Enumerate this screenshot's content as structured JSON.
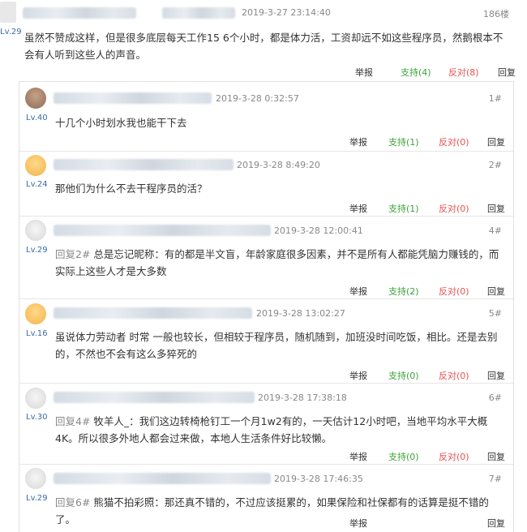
{
  "main_post": {
    "level": "Lv.29",
    "date": "2019-3-27 23:14:40",
    "floor": "186楼",
    "content": "虽然不赞成这样，但是很多底层每天工作15 6个小时，都是体力活，工资却远不如这些程序员，然鹅根本不会有人听到这些人的声音。",
    "actions": {
      "report": "举报",
      "support": "支持(4)",
      "oppose": "反对(8)",
      "reply": "回复"
    }
  },
  "replies": [
    {
      "level": "Lv.40",
      "date": "2019-3-28 0:32:57",
      "floor": "1#",
      "avatar": "avatar-icon",
      "prefix": "",
      "content": "十几个小时划水我也能干下去",
      "actions": {
        "report": "举报",
        "support": "支持(1)",
        "oppose": "反对(0)",
        "reply": "回复"
      }
    },
    {
      "level": "Lv.24",
      "date": "2019-3-28 8:49:20",
      "floor": "2#",
      "avatar": "avatar-icon",
      "prefix": "",
      "content": "那他们为什么不去干程序员的活？",
      "actions": {
        "report": "举报",
        "support": "支持(1)",
        "oppose": "反对(0)",
        "reply": "回复"
      }
    },
    {
      "level": "Lv.29",
      "date": "2019-3-28 12:00:41",
      "floor": "4#",
      "avatar": "avatar-icon",
      "prefix": "回复2#",
      "content": "总是忘记昵称：有的都是半文盲，年龄家庭很多因素，并不是所有人都能凭脑力赚钱的，而实际上这些人才是大多数",
      "actions": {
        "report": "举报",
        "support": "支持(2)",
        "oppose": "反对(0)",
        "reply": "回复"
      }
    },
    {
      "level": "Lv.16",
      "date": "2019-3-28 13:02:27",
      "floor": "5#",
      "avatar": "avatar-icon",
      "prefix": "",
      "content": "虽说体力劳动者 时常 一般也较长，但相较于程序员，随机随到，加班没时间吃饭，相比。还是去别的，不然也不会有这么多猝死的",
      "actions": {
        "report": "举报",
        "support": "支持(0)",
        "oppose": "反对(0)",
        "reply": "回复"
      }
    },
    {
      "level": "Lv.30",
      "date": "2019-3-28 17:38:18",
      "floor": "6#",
      "avatar": "avatar-icon",
      "prefix": "回复4#",
      "content": "牧羊人_：我们这边转椅枪钉工一个月1w2有的，一天估计12小时吧，当地平均水平大概4K。所以很多外地人都会过来做，本地人生活条件好比较懒。",
      "actions": {
        "report": "举报",
        "support": "支持(0)",
        "oppose": "反对(0)",
        "reply": "回复"
      }
    },
    {
      "level": "Lv.29",
      "date": "2019-3-28 17:46:35",
      "floor": "7#",
      "avatar": "avatar-icon",
      "prefix": "回复6#",
      "content": "熊猫不拍彩照：那还真不错的，不过应该挺累的，如果保险和社保都有的话算是挺不错的了。",
      "actions": {
        "report": "举报",
        "support": "",
        "oppose": "",
        "reply": "回复"
      }
    }
  ]
}
